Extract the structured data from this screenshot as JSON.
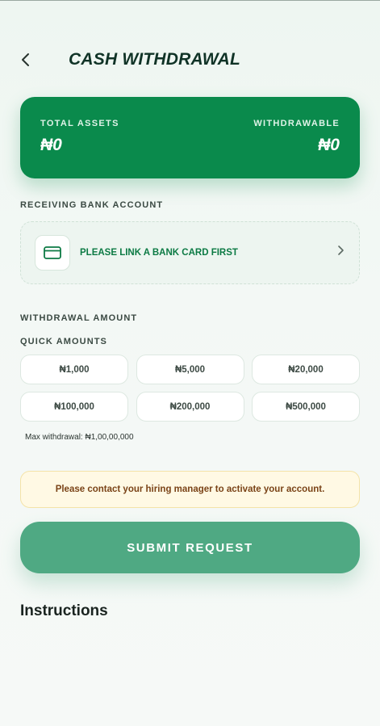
{
  "header": {
    "title": "CASH WITHDRAWAL"
  },
  "assets": {
    "total_label": "TOTAL ASSETS",
    "total_value": "₦0",
    "withdrawable_label": "WITHDRAWABLE",
    "withdrawable_value": "₦0"
  },
  "bank": {
    "section_label": "RECEIVING BANK ACCOUNT",
    "prompt": "PLEASE LINK A BANK CARD FIRST"
  },
  "withdrawal": {
    "section_label": "WITHDRAWAL AMOUNT",
    "quick_label": "QUICK AMOUNTS",
    "quick_amounts": [
      "₦1,000",
      "₦5,000",
      "₦20,000",
      "₦100,000",
      "₦200,000",
      "₦500,000"
    ],
    "max_text": "Max withdrawal: ₦1,00,00,000"
  },
  "notice": {
    "text": "Please contact your hiring manager to activate your account."
  },
  "submit": {
    "label": "SUBMIT REQUEST"
  },
  "instructions": {
    "title": "Instructions"
  },
  "colors": {
    "accent": "#0a8a4c",
    "submit": "#4fa983",
    "notice_bg": "#fff9e4",
    "notice_text": "#7a4317"
  },
  "icons": {
    "back": "chevron-left-icon",
    "bank": "credit-card-icon",
    "forward": "chevron-right-icon"
  }
}
